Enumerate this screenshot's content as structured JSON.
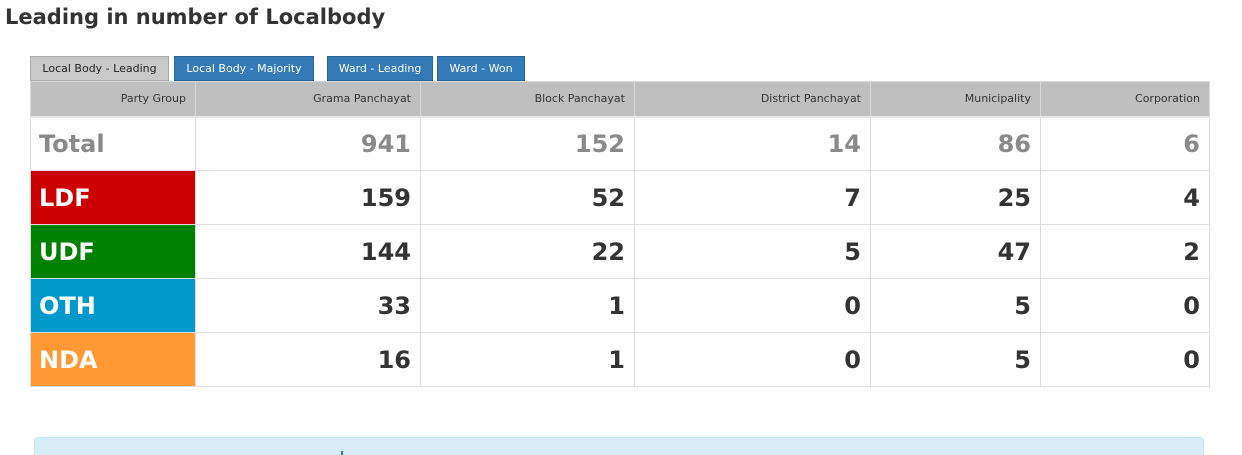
{
  "page_title": "Leading in number of Localbody",
  "tabs": [
    {
      "label": "Local Body - Leading",
      "active": true
    },
    {
      "label": "Local Body - Majority",
      "active": false
    },
    {
      "label": "Ward - Leading",
      "active": false
    },
    {
      "label": "Ward - Won",
      "active": false
    }
  ],
  "table": {
    "headers": [
      "Party Group",
      "Grama Panchayat",
      "Block Panchayat",
      "District Panchayat",
      "Municipality",
      "Corporation"
    ],
    "rows": [
      {
        "party": "Total",
        "values": [
          "941",
          "152",
          "14",
          "86",
          "6"
        ],
        "color": "#ffffff"
      },
      {
        "party": "LDF",
        "values": [
          "159",
          "52",
          "7",
          "25",
          "4"
        ],
        "color": "#cc0000"
      },
      {
        "party": "UDF",
        "values": [
          "144",
          "22",
          "5",
          "47",
          "2"
        ],
        "color": "#008000"
      },
      {
        "party": "OTH",
        "values": [
          "33",
          "1",
          "0",
          "5",
          "0"
        ],
        "color": "#0099cc"
      },
      {
        "party": "NDA",
        "values": [
          "16",
          "1",
          "0",
          "5",
          "0"
        ],
        "color": "#ff9933"
      }
    ]
  },
  "colors": {
    "tab_active": "#c9c9c9",
    "tab_inactive": "#337ab7",
    "header_bg": "#bfbfbf",
    "info_box": "#d9edf7"
  }
}
